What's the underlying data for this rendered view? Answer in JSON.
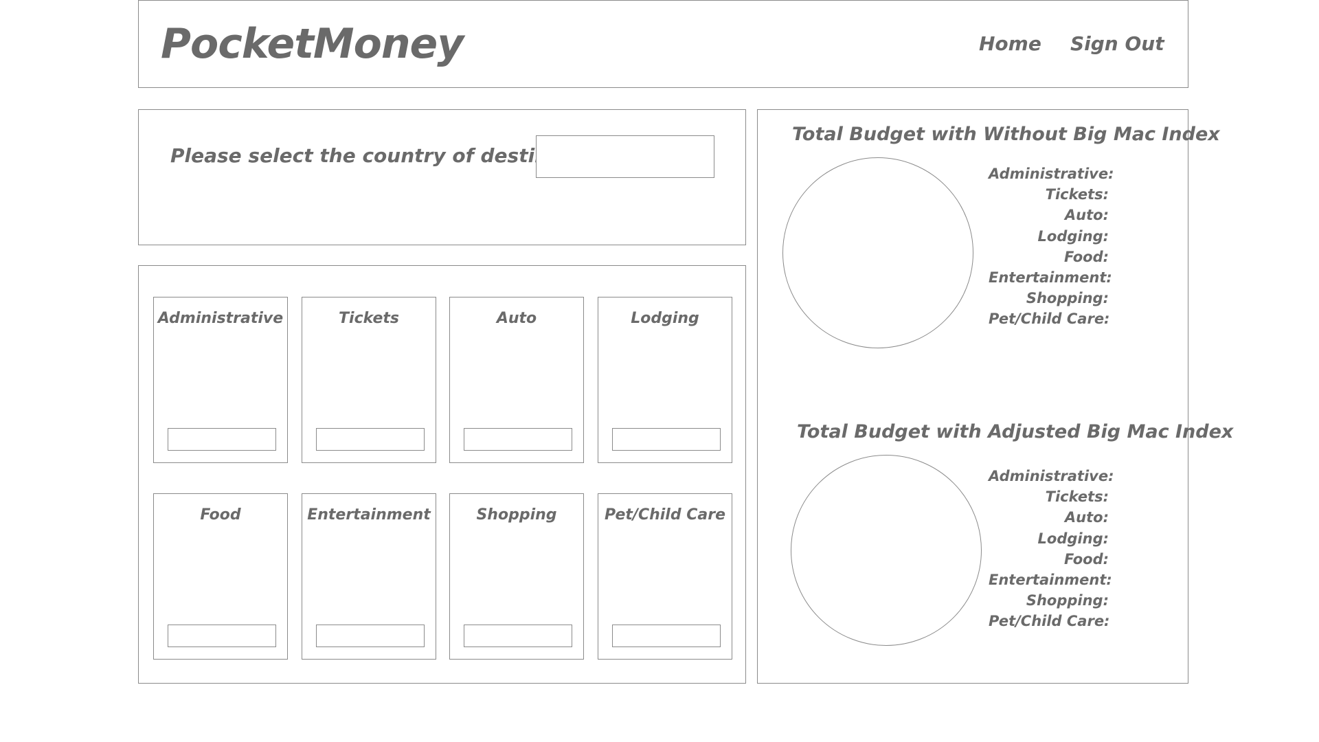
{
  "header": {
    "logo": "PocketMoney",
    "nav": {
      "home": "Home",
      "sign_out": "Sign Out"
    }
  },
  "country": {
    "label": "Please select the country of destination:",
    "value": ""
  },
  "categories": [
    {
      "label": "Administrative",
      "value": ""
    },
    {
      "label": "Tickets",
      "value": ""
    },
    {
      "label": "Auto",
      "value": ""
    },
    {
      "label": "Lodging",
      "value": ""
    },
    {
      "label": "Food",
      "value": ""
    },
    {
      "label": "Entertainment",
      "value": ""
    },
    {
      "label": "Shopping",
      "value": ""
    },
    {
      "label": "Pet/Child Care",
      "value": ""
    }
  ],
  "budget_without": {
    "title": "Total Budget with Without Big Mac Index",
    "legend": [
      "Administrative:",
      "Tickets:",
      "Auto:",
      "Lodging:",
      "Food:",
      "Entertainment:",
      "Shopping:",
      "Pet/Child Care:"
    ]
  },
  "budget_adjusted": {
    "title": "Total Budget with Adjusted Big Mac Index",
    "legend": [
      "Administrative:",
      "Tickets:",
      "Auto:",
      "Lodging:",
      "Food:",
      "Entertainment:",
      "Shopping:",
      "Pet/Child Care:"
    ]
  }
}
